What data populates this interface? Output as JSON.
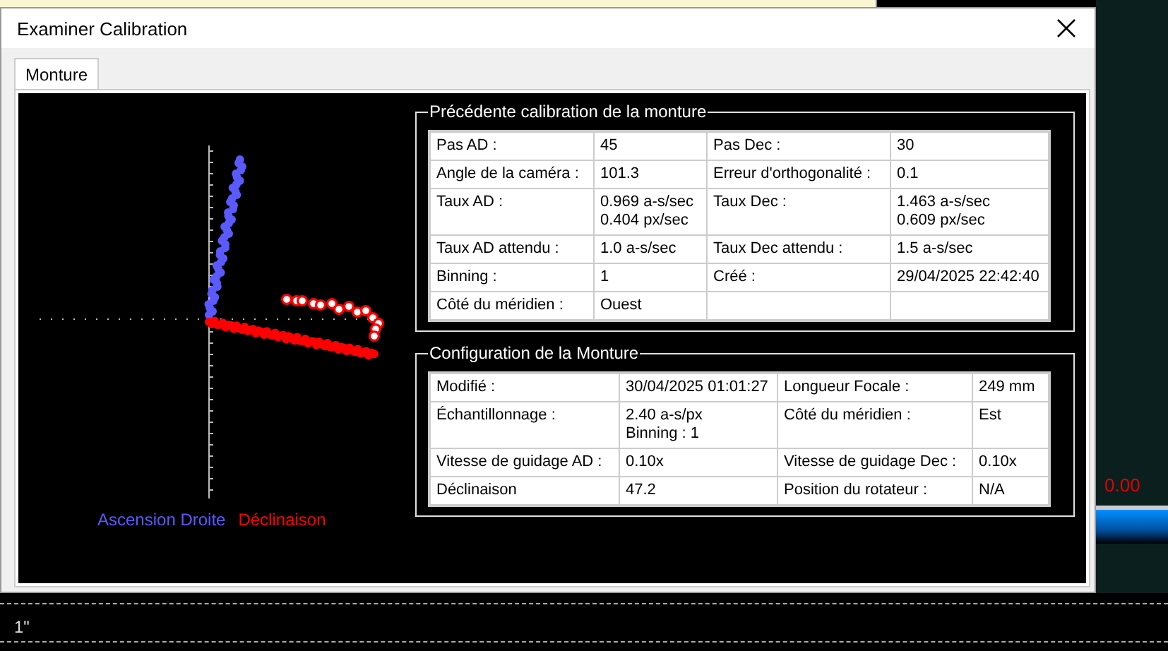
{
  "background": {
    "reading": "0.00",
    "grid_label": "1\""
  },
  "window": {
    "title": "Examiner Calibration"
  },
  "tabs": [
    {
      "label": "Monture",
      "selected": true
    }
  ],
  "plot": {
    "legend": [
      {
        "label": "Ascension Droite",
        "color": "#5a5aff"
      },
      {
        "label": "Déclinaison",
        "color": "#ff0000"
      }
    ]
  },
  "previous_calibration": {
    "title": "Précédente calibration de la monture",
    "rows": [
      [
        "Pas AD :",
        "45",
        "Pas Dec :",
        "30"
      ],
      [
        "Angle de la caméra :",
        "101.3",
        "Erreur d'orthogonalité :",
        "0.1"
      ],
      [
        "Taux AD :",
        "0.969 a-s/sec\n0.404 px/sec",
        "Taux Dec :",
        "1.463 a-s/sec\n0.609 px/sec"
      ],
      [
        "Taux AD attendu :",
        "1.0 a-s/sec",
        "Taux Dec attendu :",
        "1.5 a-s/sec"
      ],
      [
        "Binning :",
        "1",
        "Créé :",
        "29/04/2025 22:42:40"
      ],
      [
        "Côté du méridien :",
        "Ouest"
      ]
    ]
  },
  "mount_configuration": {
    "title": "Configuration de la Monture",
    "rows": [
      [
        "Modifié :",
        "30/04/2025 01:01:27",
        "Longueur Focale :",
        "249 mm"
      ],
      [
        "Échantillonnage :",
        "2.40 a-s/px\nBinning : 1",
        "Côté du méridien :",
        "Est"
      ],
      [
        "Vitesse de guidage AD :",
        "0.10x",
        "Vitesse de guidage Dec :",
        "0.10x"
      ],
      [
        "Déclinaison",
        "47.2",
        "Position du rotateur :",
        "N/A"
      ]
    ]
  }
}
